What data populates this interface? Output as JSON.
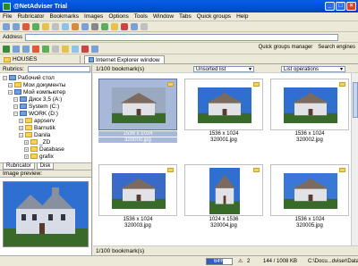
{
  "window": {
    "title": "@NetAdviser Trial"
  },
  "menu": [
    "File",
    "Rubricator",
    "Bookmarks",
    "Images",
    "Options",
    "Tools",
    "Window",
    "Tabs",
    "Quick groups",
    "Help"
  ],
  "address": {
    "label": "Address",
    "value": ""
  },
  "navbar": {
    "quick_groups": "Quick groups manager",
    "search": "Search engines"
  },
  "tabs": {
    "folder": "HOUSES",
    "ie": "Internet Explorer window"
  },
  "left": {
    "rubrics_label": "Rubrics:",
    "tree": [
      {
        "label": "Рабочий стол",
        "icon": "desktop-icon",
        "level": 0
      },
      {
        "label": "Мои документы",
        "icon": "folder-icon",
        "level": 1
      },
      {
        "label": "Мой компьютер",
        "icon": "computer-icon",
        "level": 1
      },
      {
        "label": "Диск 3,5 (A:)",
        "icon": "floppy-icon",
        "level": 2
      },
      {
        "label": "System (C:)",
        "icon": "drive-icon",
        "level": 2
      },
      {
        "label": "WORK (D:)",
        "icon": "drive-icon",
        "level": 2
      },
      {
        "label": "appserv",
        "icon": "folder-icon",
        "level": 3
      },
      {
        "label": "Barnutik",
        "icon": "folder-icon",
        "level": 3
      },
      {
        "label": "Danila",
        "icon": "folder-icon",
        "level": 3
      },
      {
        "label": "_ZD",
        "icon": "folder-icon",
        "level": 4
      },
      {
        "label": "Database",
        "icon": "folder-icon",
        "level": 4
      },
      {
        "label": "grafix",
        "icon": "folder-icon",
        "level": 4
      }
    ],
    "tab_rubricator": "Rubricator",
    "tab_disk": "Disk",
    "preview_label": "Image preview:"
  },
  "main": {
    "bookmark_count": "1/100 bookmark(s)",
    "sort": "Unsorted list",
    "list_ops": "List operations",
    "footer_count": "1/100 bookmark(s)",
    "items": [
      {
        "size": "1536 x 1024",
        "file": "320000.jpg",
        "selected": true
      },
      {
        "size": "1536 x 1024",
        "file": "320001.jpg",
        "selected": false
      },
      {
        "size": "1536 x 1024",
        "file": "320002.jpg",
        "selected": false
      },
      {
        "size": "1536 x 1024",
        "file": "320003.jpg",
        "selected": false
      },
      {
        "size": "1024 x 1536",
        "file": "320004.jpg",
        "selected": false
      },
      {
        "size": "1536 x 1024",
        "file": "320005.jpg",
        "selected": false
      }
    ]
  },
  "status": {
    "progress_pct": 64,
    "progress_label": "64%",
    "count": "2",
    "mem": "144 / 1008 KB",
    "path": "C:\\Docu...dviser\\Data"
  },
  "colors": {
    "title_bar": "#0a5ee8",
    "selection": "#a8b8d8",
    "sky": "#2f6fd0"
  }
}
